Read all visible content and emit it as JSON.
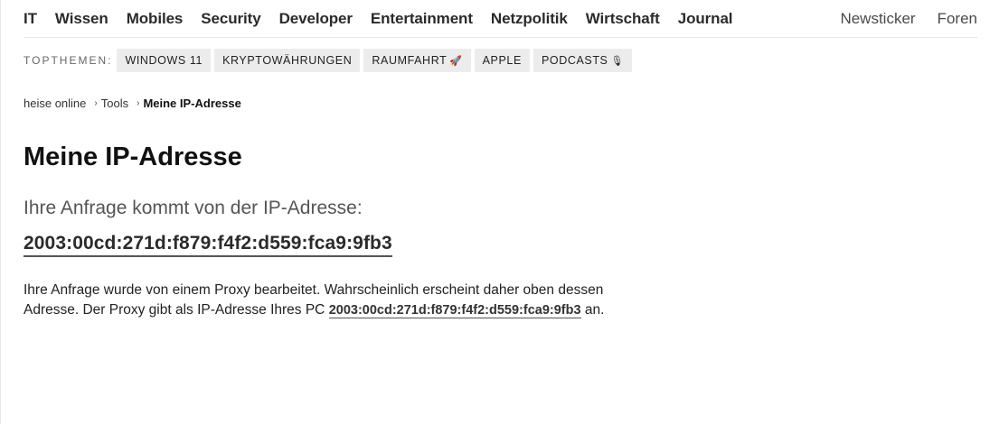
{
  "nav": {
    "left": [
      {
        "label": "IT"
      },
      {
        "label": "Wissen"
      },
      {
        "label": "Mobiles"
      },
      {
        "label": "Security"
      },
      {
        "label": "Developer"
      },
      {
        "label": "Entertainment"
      },
      {
        "label": "Netzpolitik"
      },
      {
        "label": "Wirtschaft"
      },
      {
        "label": "Journal"
      }
    ],
    "right": [
      {
        "label": "Newsticker"
      },
      {
        "label": "Foren"
      }
    ]
  },
  "topthemen": {
    "label": "TOPTHEMEN:",
    "chips": [
      {
        "label": "WINDOWS 11",
        "icon": ""
      },
      {
        "label": "KRYPTOWÄHRUNGEN",
        "icon": ""
      },
      {
        "label": "RAUMFAHRT",
        "icon": "🚀"
      },
      {
        "label": "APPLE",
        "icon": ""
      },
      {
        "label": "PODCASTS",
        "icon": "🎙"
      }
    ]
  },
  "breadcrumb": {
    "items": [
      "heise online",
      "Tools"
    ],
    "current": "Meine IP-Adresse",
    "separator": "›"
  },
  "main": {
    "title": "Meine IP-Adresse",
    "lead": "Ihre Anfrage kommt von der IP-Adresse:",
    "ip": "2003:00cd:271d:f879:f4f2:d559:fca9:9fb3",
    "info_part1": "Ihre Anfrage wurde von einem Proxy bearbeitet. Wahrscheinlich erscheint daher oben dessen Adresse. Der Proxy gibt als IP-Adresse Ihres PC ",
    "info_ip": "2003:00cd:271d:f879:f4f2:d559:fca9:9fb3",
    "info_part2": " an."
  }
}
